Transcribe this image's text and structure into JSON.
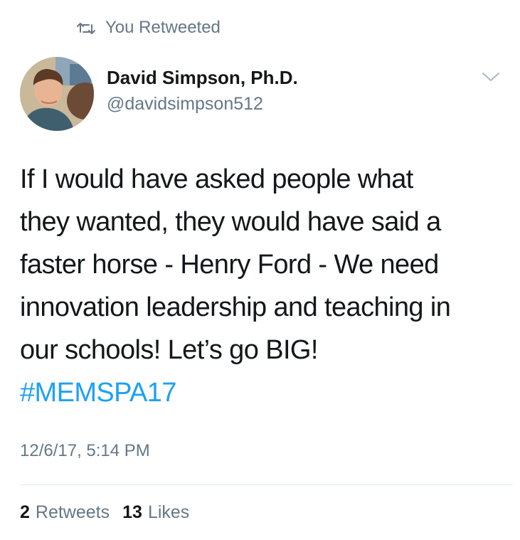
{
  "retweet_context": {
    "icon": "retweet-icon",
    "label": "You Retweeted"
  },
  "author": {
    "display_name": "David Simpson, Ph.D.",
    "handle": "@davidsimpson512",
    "menu_icon": "chevron-down-icon"
  },
  "tweet": {
    "lines": [
      "If I would have asked people what",
      "they wanted, they would have said a",
      "faster horse - Henry Ford - We need",
      "innovation leadership and teaching in",
      "our schools! Let’s go BIG!"
    ],
    "hashtag": "#MEMSPA17",
    "timestamp": "12/6/17, 5:14 PM"
  },
  "stats": {
    "retweets_count": "2",
    "retweets_label": "Retweets",
    "likes_count": "13",
    "likes_label": "Likes"
  },
  "colors": {
    "text": "#14171a",
    "secondary": "#657786",
    "link": "#1da1f2",
    "divider": "#e1e8ed"
  }
}
